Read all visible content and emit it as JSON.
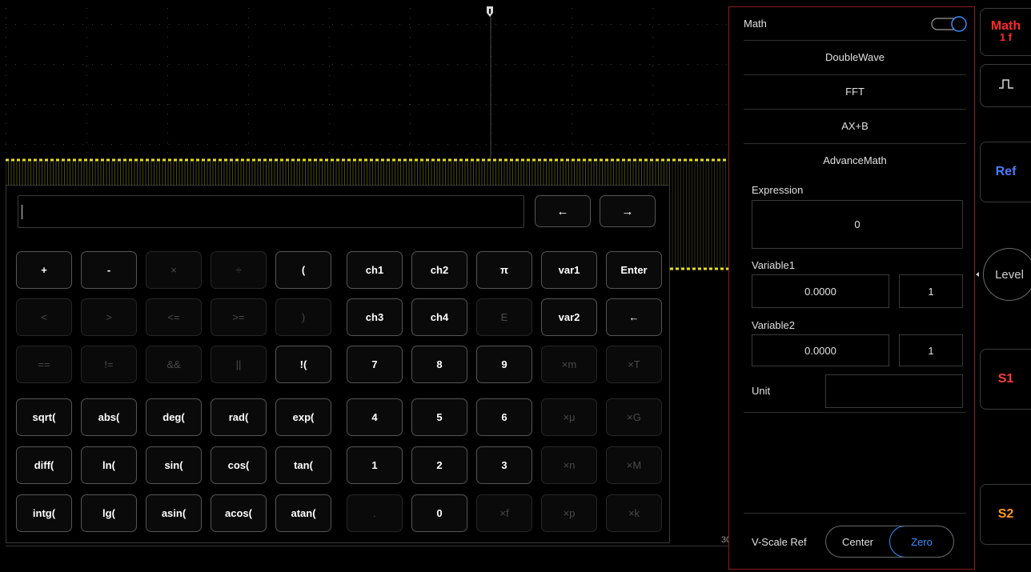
{
  "scope": {
    "time_readout": "30"
  },
  "keypad": {
    "input_value": "",
    "nav": {
      "left": "←",
      "right": "→"
    },
    "left_rows": [
      [
        {
          "label": "+",
          "enabled": true
        },
        {
          "label": "-",
          "enabled": true
        },
        {
          "label": "×",
          "enabled": false
        },
        {
          "label": "÷",
          "enabled": false
        },
        {
          "label": "(",
          "enabled": true
        }
      ],
      [
        {
          "label": "<",
          "enabled": false
        },
        {
          "label": ">",
          "enabled": false
        },
        {
          "label": "<=",
          "enabled": false
        },
        {
          "label": ">=",
          "enabled": false
        },
        {
          "label": ")",
          "enabled": false
        }
      ],
      [
        {
          "label": "==",
          "enabled": false
        },
        {
          "label": "!=",
          "enabled": false
        },
        {
          "label": "&&",
          "enabled": false
        },
        {
          "label": "||",
          "enabled": false
        },
        {
          "label": "!(",
          "enabled": true
        }
      ],
      [
        {
          "label": "sqrt(",
          "enabled": true
        },
        {
          "label": "abs(",
          "enabled": true
        },
        {
          "label": "deg(",
          "enabled": true
        },
        {
          "label": "rad(",
          "enabled": true
        },
        {
          "label": "exp(",
          "enabled": true
        }
      ],
      [
        {
          "label": "diff(",
          "enabled": true
        },
        {
          "label": "ln(",
          "enabled": true
        },
        {
          "label": "sin(",
          "enabled": true
        },
        {
          "label": "cos(",
          "enabled": true
        },
        {
          "label": "tan(",
          "enabled": true
        }
      ],
      [
        {
          "label": "intg(",
          "enabled": true
        },
        {
          "label": "lg(",
          "enabled": true
        },
        {
          "label": "asin(",
          "enabled": true
        },
        {
          "label": "acos(",
          "enabled": true
        },
        {
          "label": "atan(",
          "enabled": true
        }
      ]
    ],
    "right_rows": [
      [
        {
          "label": "ch1",
          "enabled": true
        },
        {
          "label": "ch2",
          "enabled": true
        },
        {
          "label": "π",
          "enabled": true
        },
        {
          "label": "var1",
          "enabled": true
        },
        {
          "label": "Enter",
          "enabled": true
        }
      ],
      [
        {
          "label": "ch3",
          "enabled": true
        },
        {
          "label": "ch4",
          "enabled": true
        },
        {
          "label": "E",
          "enabled": false
        },
        {
          "label": "var2",
          "enabled": true
        },
        {
          "label": "←",
          "enabled": true
        }
      ],
      [
        {
          "label": "7",
          "enabled": true
        },
        {
          "label": "8",
          "enabled": true
        },
        {
          "label": "9",
          "enabled": true
        },
        {
          "label": "×m",
          "enabled": false
        },
        {
          "label": "×T",
          "enabled": false
        }
      ],
      [
        {
          "label": "4",
          "enabled": true
        },
        {
          "label": "5",
          "enabled": true
        },
        {
          "label": "6",
          "enabled": true
        },
        {
          "label": "×μ",
          "enabled": false
        },
        {
          "label": "×G",
          "enabled": false
        }
      ],
      [
        {
          "label": "1",
          "enabled": true
        },
        {
          "label": "2",
          "enabled": true
        },
        {
          "label": "3",
          "enabled": true
        },
        {
          "label": "×n",
          "enabled": false
        },
        {
          "label": "×M",
          "enabled": false
        }
      ],
      [
        {
          "label": ".",
          "enabled": false
        },
        {
          "label": "0",
          "enabled": true
        },
        {
          "label": "×f",
          "enabled": false
        },
        {
          "label": "×p",
          "enabled": false
        },
        {
          "label": "×k",
          "enabled": false
        }
      ]
    ]
  },
  "math_panel": {
    "math_label": "Math",
    "math_enabled": true,
    "modes": [
      "DoubleWave",
      "FFT",
      "AX+B",
      "AdvanceMath"
    ],
    "expression_label": "Expression",
    "expression_value": "0",
    "variable1_label": "Variable1",
    "variable1_value": "0.0000",
    "variable1_unit": "1",
    "variable2_label": "Variable2",
    "variable2_value": "0.0000",
    "variable2_unit": "1",
    "unit_label": "Unit",
    "unit_value": "",
    "vscale_label": "V-Scale Ref",
    "vscale_options": [
      "Center",
      "Zero"
    ],
    "vscale_selected": "Zero"
  },
  "sidebar": {
    "math_top": "Math",
    "math_bottom": "1 f",
    "ref": "Ref",
    "level": "Level",
    "s1": "S1",
    "s2": "S2"
  },
  "colors": {
    "trace": "#e8e020",
    "math": "#ff2a2a",
    "ref": "#4a7bff",
    "s1": "#ff3b3b",
    "s2": "#ff9a1a",
    "accent": "#3a8cff",
    "panel_border": "#8b1d1d"
  }
}
